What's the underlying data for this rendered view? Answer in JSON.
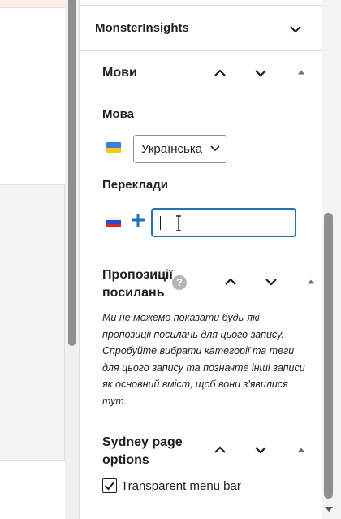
{
  "panels": {
    "monsterinsights": {
      "title": "MonsterInsights"
    },
    "languages": {
      "title": "Мови",
      "language_label": "Мова",
      "language_select_value": "Українська",
      "translations_label": "Переклади",
      "translation_input_value": ""
    },
    "link_suggestions": {
      "title_line1": "Пропозиції",
      "title_line2": "посилань",
      "help_glyph": "?",
      "message": "Ми не можемо показати будь-які пропозиції посилань для цього запису. Спробуйте вибрати категорії та теги для цього запису та позначте інші записи як основний вміст, щоб вони з'явилися тут."
    },
    "sydney_page_options": {
      "title_line1": "Sydney page",
      "title_line2": "options",
      "transparent_menu_bar_label": "Transparent menu bar",
      "transparent_menu_bar_checked": true
    }
  },
  "icons": {
    "flag_ua": "flag-ukraine-icon",
    "flag_ru": "flag-russia-icon",
    "add": "plus-icon",
    "move_up": "chevron-up-icon",
    "move_down": "chevron-down-icon",
    "collapse": "triangle-up-icon"
  },
  "colors": {
    "accent": "#2271b1",
    "text": "#1e1e1e",
    "notice_background": "#fcf0e6"
  }
}
